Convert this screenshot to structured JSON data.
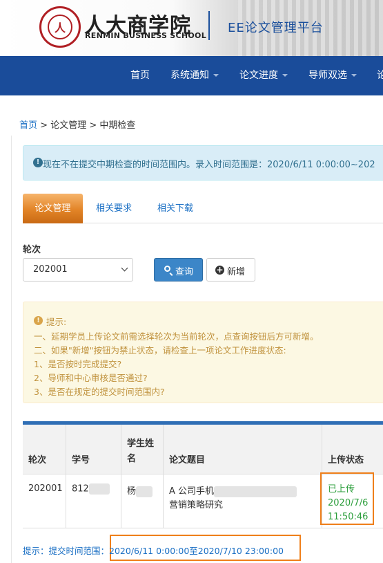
{
  "header": {
    "school_cn": "人大商学院",
    "school_en": "RENMIN BUSINESS SCHOOL",
    "platform": "EE论文管理平台",
    "seal_char": "人"
  },
  "nav": {
    "items": [
      {
        "label": "首页",
        "dropdown": false
      },
      {
        "label": "系统通知",
        "dropdown": true
      },
      {
        "label": "论文进度",
        "dropdown": true
      },
      {
        "label": "导师双选",
        "dropdown": true
      },
      {
        "label": "论",
        "dropdown": false
      }
    ]
  },
  "breadcrumb": {
    "home": "首页",
    "sep1": " > ",
    "level2": "论文管理",
    "sep2": " > ",
    "current": "中期检查"
  },
  "info_alert": {
    "icon": "info-icon",
    "text": "现在不在提交中期检查的时间范围内。录入时间范围是：2020/6/11 0:00:00~202"
  },
  "tabs": [
    {
      "label": "论文管理",
      "active": true
    },
    {
      "label": "相关要求",
      "active": false
    },
    {
      "label": "相关下载",
      "active": false
    }
  ],
  "filter": {
    "round_label": "轮次",
    "round_value": "202001",
    "query_label": "查询",
    "add_label": "新增"
  },
  "warn_alert": {
    "title": "提示:",
    "lines": [
      "一、延期学员上传论文前需选择轮次为当前轮次，点查询按钮后方可新增。",
      "二、如果\"新增\"按钮为禁止状态，请检查上一项论文工作进度状态:",
      "1、是否按时完成提交?",
      "2、导师和中心审核是否通过?",
      "3、是否在规定的提交时间范围内?"
    ]
  },
  "table": {
    "headers": {
      "round": "轮次",
      "student_id": "学号",
      "name_l1": "学生姓",
      "name_l2": "名",
      "title": "论文题目",
      "upload_status": "上传状态"
    },
    "row": {
      "round": "202001",
      "student_id": "812",
      "name": "杨",
      "title_l1": "A 公司手机",
      "title_l2": "营销策略研究",
      "status": "已上传",
      "date": "2020/7/6",
      "time": "11:50:46"
    }
  },
  "footer": {
    "label": "提示：提交时间范围：",
    "range": "2020/6/11 0:00:00至2020/7/10 23:00:00"
  },
  "colors": {
    "nav_bg": "#1a4c9a",
    "brand_red": "#b01f24",
    "highlight_orange": "#ef7f1a",
    "status_green": "#2a9d3a",
    "link_blue": "#1a6fc4"
  }
}
